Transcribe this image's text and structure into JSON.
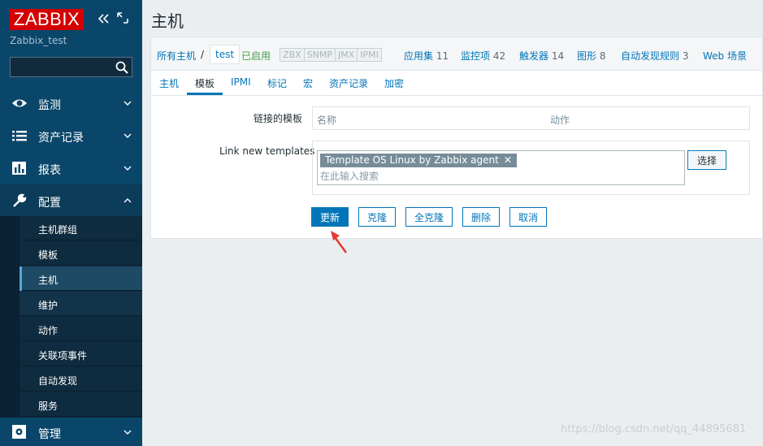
{
  "sidebar": {
    "logo": "ZABBIX",
    "server_name": "Zabbix_test",
    "search_placeholder": "",
    "menu": [
      {
        "label": "监测",
        "icon": "eye-icon"
      },
      {
        "label": "资产记录",
        "icon": "list-icon"
      },
      {
        "label": "报表",
        "icon": "bar-chart-icon"
      },
      {
        "label": "配置",
        "icon": "wrench-icon"
      }
    ],
    "submenu": [
      "主机群组",
      "模板",
      "主机",
      "维护",
      "动作",
      "关联项事件",
      "自动发现",
      "服务"
    ],
    "admin_label": "管理"
  },
  "page": {
    "title": "主机"
  },
  "breadcrumb": {
    "all_hosts": "所有主机",
    "separator": "/",
    "current": "test",
    "status": "已启用",
    "availability": [
      "ZBX",
      "SNMP",
      "JMX",
      "IPMI"
    ],
    "links": [
      {
        "label": "应用集",
        "count": "11"
      },
      {
        "label": "监控项",
        "count": "42"
      },
      {
        "label": "触发器",
        "count": "14"
      },
      {
        "label": "图形",
        "count": "8"
      },
      {
        "label": "自动发现规则",
        "count": "3"
      },
      {
        "label": "Web 场景",
        "count": ""
      }
    ]
  },
  "tabs": [
    "主机",
    "模板",
    "IPMI",
    "标记",
    "宏",
    "资产记录",
    "加密"
  ],
  "form": {
    "linked_label": "链接的模板",
    "col_name": "名称",
    "col_action": "动作",
    "new_label": "Link new templates",
    "tag": "Template OS Linux by Zabbix agent",
    "search_placeholder": "在此输入搜索",
    "select_btn": "选择"
  },
  "buttons": {
    "update": "更新",
    "clone": "克隆",
    "full_clone": "全克隆",
    "delete": "删除",
    "cancel": "取消"
  },
  "watermark": "https://blog.csdn.net/qq_44895681",
  "colors": {
    "sidebar": "#0a466a",
    "accent": "#0275b8",
    "logo": "#d40000",
    "enabled": "#429e47"
  }
}
